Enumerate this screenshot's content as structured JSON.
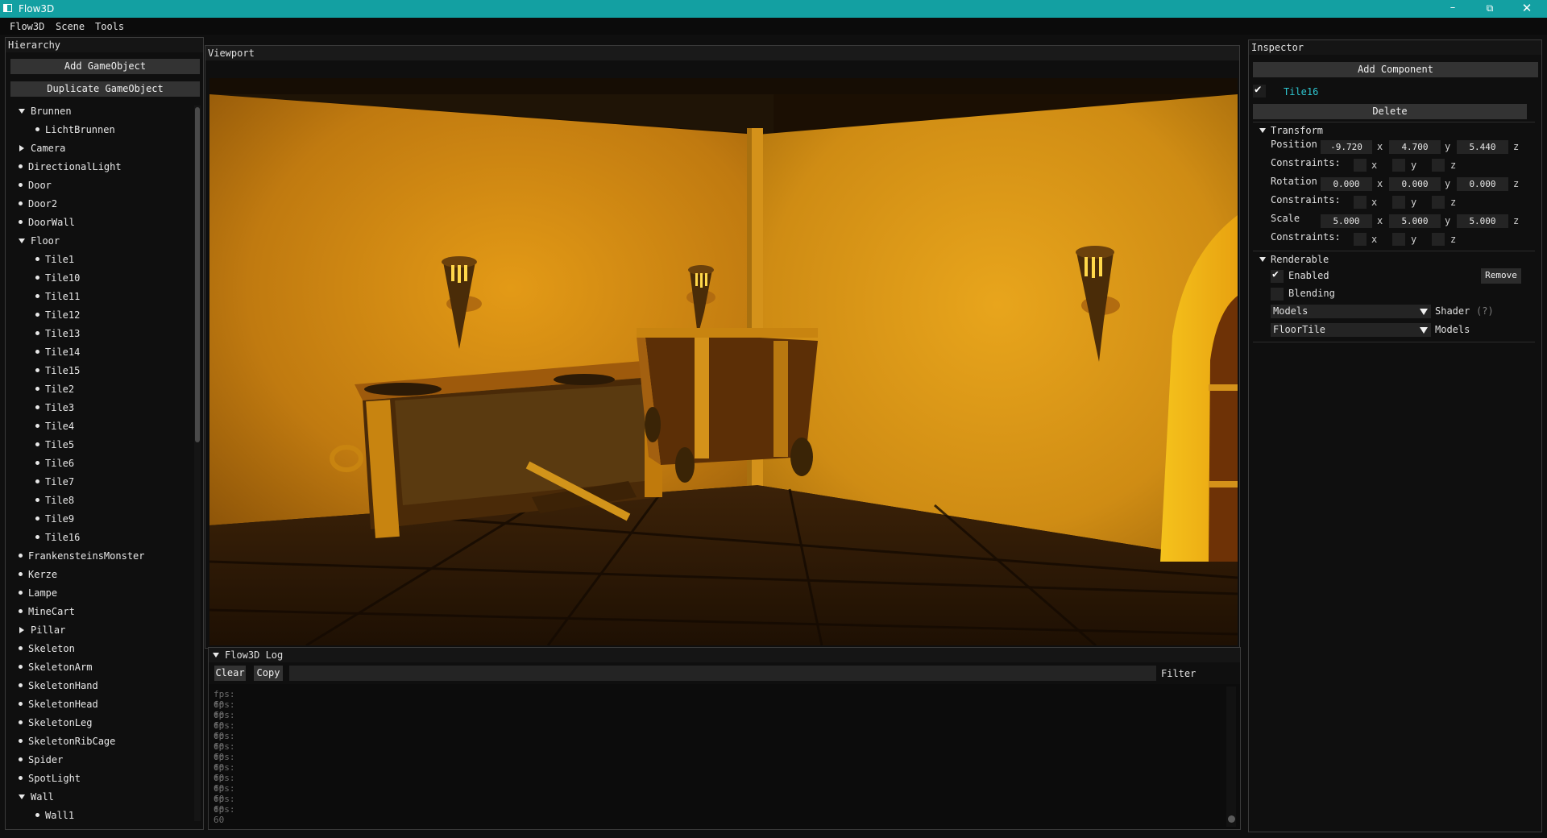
{
  "window": {
    "title": "Flow3D",
    "controls": [
      "minimize-icon",
      "restore-icon",
      "close-icon"
    ]
  },
  "menu": [
    "Flow3D",
    "Scene",
    "Tools"
  ],
  "hierarchy": {
    "title": "Hierarchy",
    "add_button": "Add GameObject",
    "duplicate_button": "Duplicate GameObject",
    "items": [
      {
        "label": "Brunnen",
        "icon": "arrow-down",
        "depth": 0
      },
      {
        "label": "LichtBrunnen",
        "icon": "bullet",
        "depth": 1
      },
      {
        "label": "Camera",
        "icon": "arrow-right",
        "depth": 0
      },
      {
        "label": "DirectionalLight",
        "icon": "bullet",
        "depth": 0
      },
      {
        "label": "Door",
        "icon": "bullet",
        "depth": 0
      },
      {
        "label": "Door2",
        "icon": "bullet",
        "depth": 0
      },
      {
        "label": "DoorWall",
        "icon": "bullet",
        "depth": 0
      },
      {
        "label": "Floor",
        "icon": "arrow-down",
        "depth": 0
      },
      {
        "label": "Tile1",
        "icon": "bullet",
        "depth": 1
      },
      {
        "label": "Tile10",
        "icon": "bullet",
        "depth": 1
      },
      {
        "label": "Tile11",
        "icon": "bullet",
        "depth": 1
      },
      {
        "label": "Tile12",
        "icon": "bullet",
        "depth": 1
      },
      {
        "label": "Tile13",
        "icon": "bullet",
        "depth": 1
      },
      {
        "label": "Tile14",
        "icon": "bullet",
        "depth": 1
      },
      {
        "label": "Tile15",
        "icon": "bullet",
        "depth": 1
      },
      {
        "label": "Tile2",
        "icon": "bullet",
        "depth": 1
      },
      {
        "label": "Tile3",
        "icon": "bullet",
        "depth": 1
      },
      {
        "label": "Tile4",
        "icon": "bullet",
        "depth": 1
      },
      {
        "label": "Tile5",
        "icon": "bullet",
        "depth": 1
      },
      {
        "label": "Tile6",
        "icon": "bullet",
        "depth": 1
      },
      {
        "label": "Tile7",
        "icon": "bullet",
        "depth": 1
      },
      {
        "label": "Tile8",
        "icon": "bullet",
        "depth": 1
      },
      {
        "label": "Tile9",
        "icon": "bullet",
        "depth": 1
      },
      {
        "label": "Tile16",
        "icon": "bullet",
        "depth": 1
      },
      {
        "label": "FrankensteinsMonster",
        "icon": "bullet",
        "depth": 0
      },
      {
        "label": "Kerze",
        "icon": "bullet",
        "depth": 0
      },
      {
        "label": "Lampe",
        "icon": "bullet",
        "depth": 0
      },
      {
        "label": "MineCart",
        "icon": "bullet",
        "depth": 0
      },
      {
        "label": "Pillar",
        "icon": "arrow-right",
        "depth": 0
      },
      {
        "label": "Skeleton",
        "icon": "bullet",
        "depth": 0
      },
      {
        "label": "SkeletonArm",
        "icon": "bullet",
        "depth": 0
      },
      {
        "label": "SkeletonHand",
        "icon": "bullet",
        "depth": 0
      },
      {
        "label": "SkeletonHead",
        "icon": "bullet",
        "depth": 0
      },
      {
        "label": "SkeletonLeg",
        "icon": "bullet",
        "depth": 0
      },
      {
        "label": "SkeletonRibCage",
        "icon": "bullet",
        "depth": 0
      },
      {
        "label": "Spider",
        "icon": "bullet",
        "depth": 0
      },
      {
        "label": "SpotLight",
        "icon": "bullet",
        "depth": 0
      },
      {
        "label": "Wall",
        "icon": "arrow-down",
        "depth": 0
      },
      {
        "label": "Wall1",
        "icon": "bullet",
        "depth": 1
      }
    ]
  },
  "viewport": {
    "title": "Viewport"
  },
  "log": {
    "title": "Flow3D Log",
    "clear_button": "Clear",
    "copy_button": "Copy",
    "filter_value": "",
    "filter_label": "Filter",
    "lines": [
      "fps: 60",
      "fps: 60",
      "fps: 60",
      "fps: 60",
      "fps: 60",
      "fps: 60",
      "fps: 60",
      "fps: 60",
      "fps: 60",
      "fps: 60",
      "fps: 60",
      "fps: 60"
    ]
  },
  "inspector": {
    "title": "Inspector",
    "add_component_button": "Add Component",
    "object_enabled": true,
    "object_name": "Tile16",
    "delete_button": "Delete",
    "transform": {
      "header": "Transform",
      "position_label": "Position",
      "position": [
        "-9.720",
        "4.700",
        "5.440"
      ],
      "rotation_label": "Rotation",
      "rotation": [
        "0.000",
        "0.000",
        "0.000"
      ],
      "scale_label": "Scale",
      "scale": [
        "5.000",
        "5.000",
        "5.000"
      ],
      "constraints_label": "Constraints:",
      "axes": [
        "x",
        "y",
        "z"
      ]
    },
    "renderable": {
      "header": "Renderable",
      "enabled_label": "Enabled",
      "enabled": true,
      "remove_button": "Remove",
      "blending_label": "Blending",
      "blending": false,
      "shader_select": "Models",
      "shader_label": "Shader",
      "shader_help": "(?)",
      "model_select": "FloorTile",
      "model_label": "Models"
    }
  },
  "colors": {
    "titlebar": "#13a0a2",
    "accent_text": "#2ec6d0",
    "panel_bg": "#0f0f0f",
    "button_bg": "#333333"
  }
}
